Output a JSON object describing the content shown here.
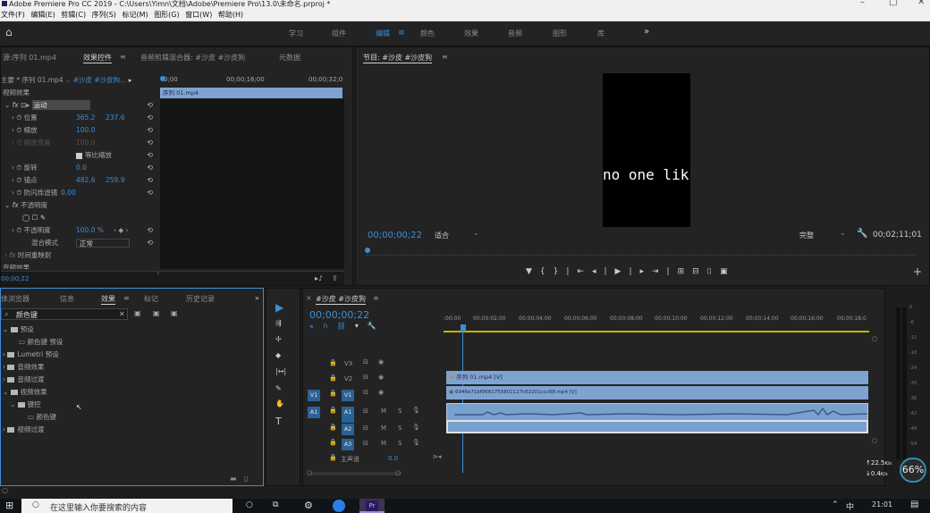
{
  "window": {
    "title": "Adobe Premiere Pro CC 2019 - C:\\Users\\Yimn\\文档\\Adobe\\Premiere Pro\\13.0\\未命名.prproj *",
    "min": "–",
    "max": "□",
    "close": "✕"
  },
  "menu": [
    "文件(F)",
    "编辑(E)",
    "剪辑(C)",
    "序列(S)",
    "标记(M)",
    "图形(G)",
    "窗口(W)",
    "帮助(H)"
  ],
  "workspaces": {
    "home": "⌂",
    "items": [
      "学习",
      "组件",
      "编辑",
      "颜色",
      "效果",
      "音频",
      "图形",
      "库"
    ],
    "active": "编辑",
    "more": "»"
  },
  "effects_panel": {
    "tabs": [
      "源:序列 01.mp4",
      "效果控件",
      "音频剪辑混合器: #沙皮 #沙皮狗",
      "元数据"
    ],
    "master": "主要 * 序列 01.mp4",
    "seq": "#沙皮 #沙皮狗...",
    "ruler": [
      "0;00",
      "00;00;16;00",
      "00;00;32;0"
    ],
    "clip_label": "序列 01.mp4",
    "section_video": "视频效果",
    "motion": "运动",
    "props": [
      {
        "name": "位置",
        "v1": "365.2",
        "v2": "237.6"
      },
      {
        "name": "缩放",
        "v1": "100.0"
      },
      {
        "name": "缩放宽度",
        "v1": "100.0"
      },
      {
        "name": "等比缩放"
      },
      {
        "name": "旋转",
        "v1": "0.0"
      },
      {
        "name": "锚点",
        "v1": "482.6",
        "v2": "259.9"
      },
      {
        "name": "防闪烁滤镜",
        "v1": "0.00"
      }
    ],
    "opacity": "不透明度",
    "opacity_prop": "不透明度",
    "opacity_val": "100.0 %",
    "blend_label": "混合模式",
    "blend_val": "正常",
    "time_remap": "时间重映射",
    "audio_effects": "音频效果",
    "timecode": "00;00;22"
  },
  "program_monitor": {
    "title": "节目: #沙皮 #沙皮狗",
    "caption": "no one lik",
    "timecode": "00;00;00;22",
    "fit": "适合",
    "quality": "完整",
    "duration": "00;02;11;01"
  },
  "project_panel": {
    "tabs": [
      "体浏览器",
      "信息",
      "效果",
      "标记",
      "历史记录"
    ],
    "search": "颜色键",
    "tree": [
      {
        "label": "预设",
        "level": 0
      },
      {
        "label": "颜色键 预设",
        "level": 1
      },
      {
        "label": "Lumetri 预设",
        "level": 0
      },
      {
        "label": "音频效果",
        "level": 0
      },
      {
        "label": "音频过渡",
        "level": 0
      },
      {
        "label": "视频效果",
        "level": 0
      },
      {
        "label": "键控",
        "level": 1
      },
      {
        "label": "颜色键",
        "level": 2
      },
      {
        "label": "视频过渡",
        "level": 0
      }
    ]
  },
  "timeline": {
    "title": "#沙皮 #沙皮狗",
    "timecode": "00;00;00;22",
    "ruler": [
      ":00;00",
      "00;00;02;00",
      "00;00;04;00",
      "00;00;06;00",
      "00;00;08;00",
      "00;00;10;00",
      "00;00;12;00",
      "00;00;14;00",
      "00;00;16;00",
      "00;00;18;0"
    ],
    "tracks": [
      {
        "name": "V3"
      },
      {
        "name": "V2"
      },
      {
        "name": "V1"
      },
      {
        "name": "A1"
      },
      {
        "name": "A2"
      },
      {
        "name": "A3"
      }
    ],
    "master": "主声道",
    "master_val": "0.0",
    "clip_v2": "序列 01.mp4 [V]",
    "clip_v1": "6946e71bf9661755801127c62201ccc68.mp4 [V]",
    "meter_ticks": [
      "0",
      "-6",
      "-12",
      "-18",
      "-24",
      "-30",
      "-36",
      "-42",
      "-48",
      "-54"
    ]
  },
  "overlay": {
    "up": "22.5",
    "down": "0.4",
    "unit": "K/s",
    "percent": "66%"
  },
  "taskbar": {
    "search": "在这里输入你要搜索的内容",
    "time": "21:01",
    "ime": "中"
  }
}
